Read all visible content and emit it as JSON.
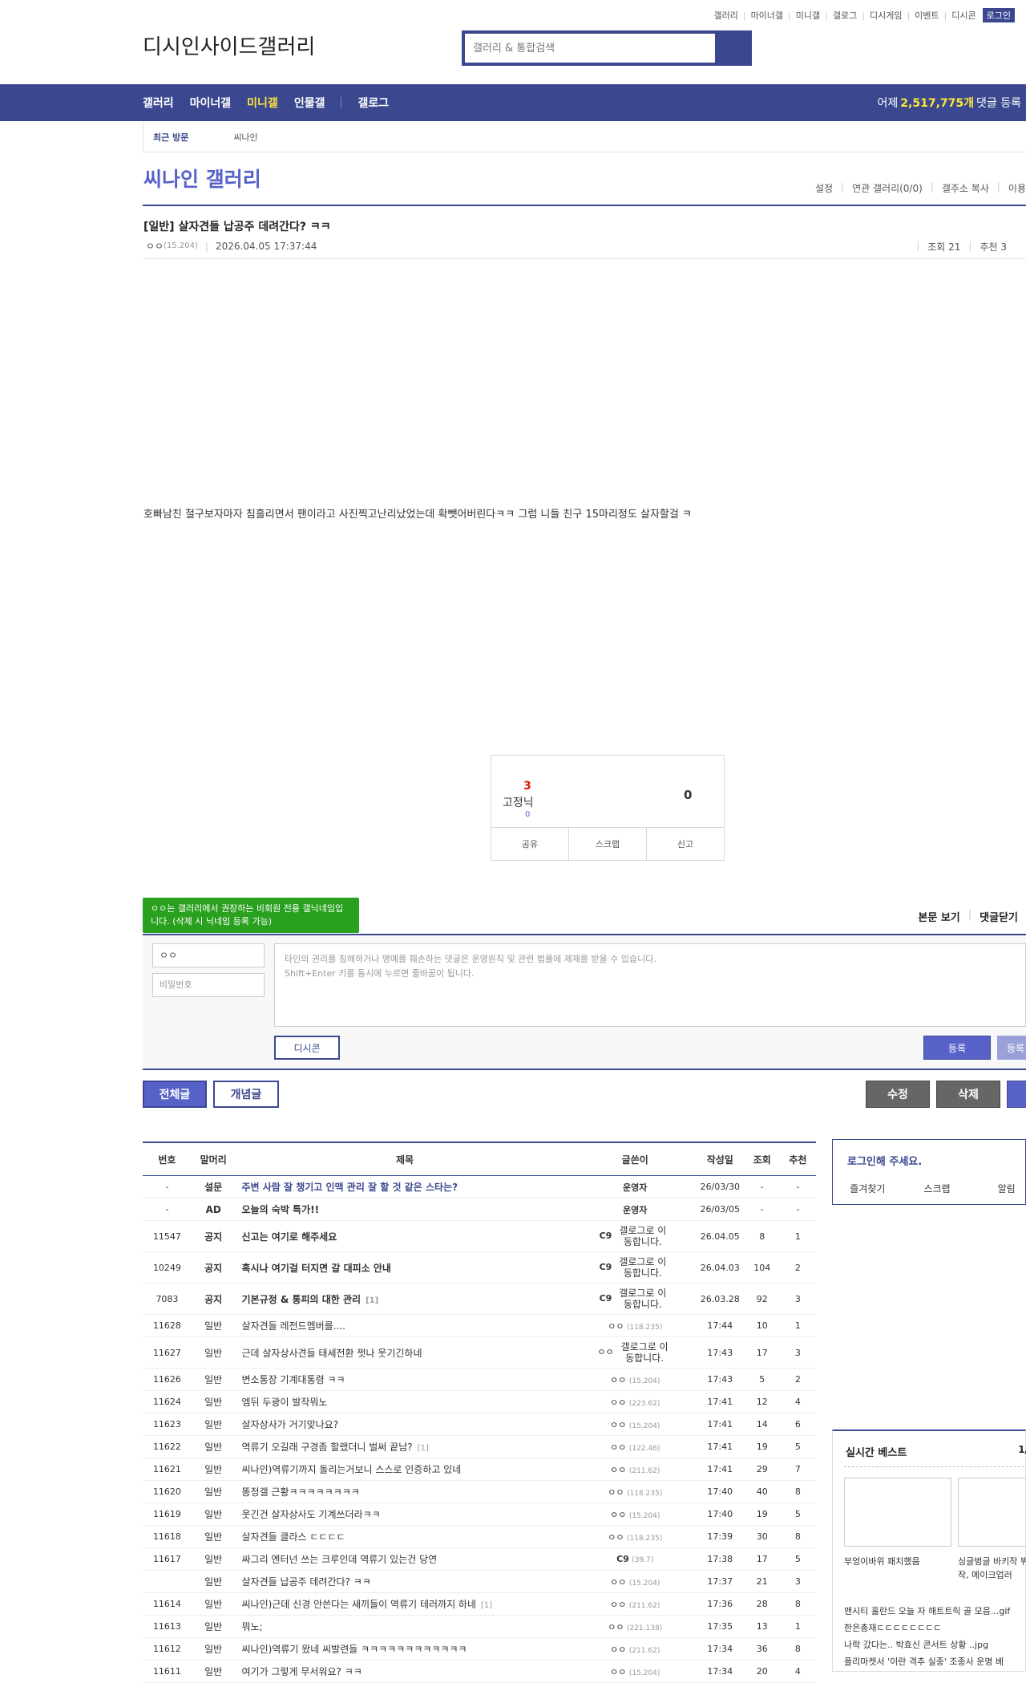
{
  "util_links": [
    "갤러리",
    "마이너갤",
    "미니갤",
    "갤로그",
    "디시게임",
    "이벤트",
    "디시콘"
  ],
  "util_login": "로그인",
  "logo_text": "디시인사이드갤러리",
  "search": {
    "placeholder": "갤러리 & 통합검색"
  },
  "nav": {
    "items": [
      {
        "label": "갤러리",
        "active": false
      },
      {
        "label": "마이너갤",
        "active": false
      },
      {
        "label": "미니갤",
        "active": true
      },
      {
        "label": "인물갤",
        "active": false
      }
    ],
    "gallog": "갤로그",
    "stat_prefix": "어제",
    "stat_count": "2,517,775개",
    "stat_suffix": "댓글 등록"
  },
  "recent": {
    "label": "최근 방문",
    "item": "씨나인"
  },
  "gallery": {
    "title": "씨나인 갤러리",
    "tools": [
      "설정",
      "연관 갤러리(0/0)",
      "갤주소 복사",
      "이용"
    ]
  },
  "post": {
    "head": "[일반]",
    "title": "살자견들 납공주 데려간다? ㅋㅋ",
    "author": "ㅇㅇ",
    "ip": "(15.204)",
    "date": "2026.04.05 17:37:44",
    "views_label": "조회 21",
    "recommend_label": "추천 3",
    "body": "호빠남친 철구보자마자 침흘리면서 팬이라고 사진찍고난리났었는데 확뺏어버린다ㅋㅋ 그럼 니들 친구 15마리정도 살자할걸 ㅋ"
  },
  "recommend": {
    "up_count": "3",
    "up_label": "고정닉",
    "fixed_count": "0",
    "down_count": "0",
    "buttons": [
      "공유",
      "스크랩",
      "신고"
    ]
  },
  "comment": {
    "tip": "ㅇㅇ는 갤러리에서 권장하는 비회원 전용 갤닉네임입니다. (삭제 시 닉네임 등록 가능)",
    "tools": [
      "본문 보기",
      "댓글닫기"
    ],
    "name": "ㅇㅇ",
    "password_placeholder": "비밀번호",
    "textarea_line1": "타인의 권리를 침해하거나 명예를 훼손하는 댓글은 운영원칙 및 관련 법률에 제재를 받을 수 있습니다.",
    "textarea_line2": "Shift+Enter 키를 동시에 누르면 줄바꿈이 됩니다.",
    "dccon": "디시콘",
    "submit": "등록",
    "submit2": "등록"
  },
  "list_buttons": {
    "all": "전체글",
    "best": "개념글",
    "edit": "수정",
    "delete": "삭제"
  },
  "list": {
    "headers": [
      "번호",
      "말머리",
      "제목",
      "글쓴이",
      "작성일",
      "조회",
      "추천"
    ],
    "rows": [
      {
        "no": "-",
        "head": "설문",
        "title": "주변 사람 잘 챙기고 인맥 관리 잘 할 것 같은 스타는?",
        "writer": "운영자",
        "ip": "",
        "date": "26/03/30",
        "views": "-",
        "rec": "-",
        "style": "survey"
      },
      {
        "no": "-",
        "head": "AD",
        "title": "오늘의 숙박 특가!!",
        "writer": "운영자",
        "ip": "",
        "date": "26/03/05",
        "views": "-",
        "rec": "-",
        "style": "ad"
      },
      {
        "no": "11547",
        "head": "공지",
        "title": "신고는 여기로 해주세요",
        "writer": "C9",
        "ip": "",
        "icon": "갤로그로 이동합니다.",
        "date": "26.04.05",
        "views": "8",
        "rec": "1",
        "style": "notice"
      },
      {
        "no": "10249",
        "head": "공지",
        "title": "혹시나 여기걸 터지면 갈 대피소 안내",
        "writer": "C9",
        "ip": "",
        "icon": "갤로그로 이동합니다.",
        "date": "26.04.03",
        "views": "104",
        "rec": "2",
        "style": "notice"
      },
      {
        "no": "7083",
        "head": "공지",
        "title": "기본규정 & 통피의 대한 관리",
        "count": "[1]",
        "writer": "C9",
        "ip": "",
        "icon": "갤로그로 이동합니다.",
        "date": "26.03.28",
        "views": "92",
        "rec": "3",
        "style": "notice"
      },
      {
        "no": "11628",
        "head": "일반",
        "title": "살자견들 레전드멤버를....",
        "writer": "ㅇㅇ",
        "ip": "(118.235)",
        "date": "17:44",
        "views": "10",
        "rec": "1"
      },
      {
        "no": "11627",
        "head": "일반",
        "title": "근데 살자상사견들 태세전환 쩟나 웃기긴하네",
        "writer": "ㅇㅇ",
        "ip": "",
        "icon": "갤로그로 이동합니다.",
        "date": "17:43",
        "views": "17",
        "rec": "3"
      },
      {
        "no": "11626",
        "head": "일반",
        "title": "변소통장 기계대통령 ㅋㅋ",
        "writer": "ㅇㅇ",
        "ip": "(15.204)",
        "date": "17:43",
        "views": "5",
        "rec": "2"
      },
      {
        "no": "11624",
        "head": "일반",
        "title": "엠뒤 두광이 발작뭐노",
        "writer": "ㅇㅇ",
        "ip": "(223.62)",
        "date": "17:41",
        "views": "12",
        "rec": "4"
      },
      {
        "no": "11623",
        "head": "일반",
        "title": "살자상사가 거기맞나요?",
        "writer": "ㅇㅇ",
        "ip": "(15.204)",
        "date": "17:41",
        "views": "14",
        "rec": "6"
      },
      {
        "no": "11622",
        "head": "일반",
        "title": "역류기 오길래 구경좀 할랬더니 벌써 끝남?",
        "count": "[1]",
        "writer": "ㅇㅇ",
        "ip": "(122.46)",
        "date": "17:41",
        "views": "19",
        "rec": "5"
      },
      {
        "no": "11621",
        "head": "일반",
        "title": "씨나인)역류기까지 돌리는거보니 스스로 인증하고 있네",
        "writer": "ㅇㅇ",
        "ip": "(211.62)",
        "date": "17:41",
        "views": "29",
        "rec": "7"
      },
      {
        "no": "11620",
        "head": "일반",
        "title": "똥정갤 근황ㅋㅋㅋㅋㅋㅋㅋㅋ",
        "writer": "ㅇㅇ",
        "ip": "(118.235)",
        "date": "17:40",
        "views": "40",
        "rec": "8"
      },
      {
        "no": "11619",
        "head": "일반",
        "title": "웃긴건 살자상사도 기계쓰더라ㅋㅋ",
        "writer": "ㅇㅇ",
        "ip": "(15.204)",
        "date": "17:40",
        "views": "19",
        "rec": "5"
      },
      {
        "no": "11618",
        "head": "일반",
        "title": "살자견들 클라스 ㄷㄷㄷㄷ",
        "writer": "ㅇㅇ",
        "ip": "(118.235)",
        "date": "17:39",
        "views": "30",
        "rec": "8"
      },
      {
        "no": "11617",
        "head": "일반",
        "title": "싸그리 엔터넌 쓰는 크루인데 역류기 있는건 당연",
        "writer": "C9",
        "ip": "(39.7)",
        "date": "17:38",
        "views": "17",
        "rec": "5"
      },
      {
        "no": "",
        "head": "일반",
        "title": "살자견들 납공주 데려간다? ㅋㅋ",
        "writer": "ㅇㅇ",
        "ip": "(15.204)",
        "date": "17:37",
        "views": "21",
        "rec": "3"
      },
      {
        "no": "11614",
        "head": "일반",
        "title": "씨나인)근데 신경 안쓴다는 새끼들이 역류기 테러까지 하네",
        "count": "[1]",
        "writer": "ㅇㅇ",
        "ip": "(211.62)",
        "date": "17:36",
        "views": "28",
        "rec": "8"
      },
      {
        "no": "11613",
        "head": "일반",
        "title": "뭐노;",
        "writer": "ㅇㅇ",
        "ip": "(221.138)",
        "date": "17:35",
        "views": "13",
        "rec": "1"
      },
      {
        "no": "11612",
        "head": "일반",
        "title": "씨나인)역류기 왔네 씨발련들 ㅋㅋㅋㅋㅋㅋㅋㅋㅋㅋㅋㅋ",
        "writer": "ㅇㅇ",
        "ip": "(211.62)",
        "date": "17:34",
        "views": "36",
        "rec": "8"
      },
      {
        "no": "11611",
        "head": "일반",
        "title": "여기가 그렇게 무서워요? ㅋㅋ",
        "writer": "ㅇㅇ",
        "ip": "(15.204)",
        "date": "17:34",
        "views": "20",
        "rec": "4"
      }
    ]
  },
  "sidebar": {
    "login_title": "로그인해 주세요.",
    "login_links": [
      "즐겨찾기",
      "스크랩",
      "알림"
    ],
    "best_title": "실시간 베스트",
    "best_page": "1/",
    "cap1": "부엉이바위 패치했음",
    "cap2": "싱글벙글 바키작 뷔작, 메이크업러",
    "best_rows": [
      "맨시티 홀란드 오늘 자 해트트릭 골 모음...gif",
      "한은총재ㄷㄷㄷㄷㄷㄷㄷㄷ",
      "나락 갔다는.. 박효신 콘서트 상황 ..jpg",
      "플리마켓서 '이란 격추 실종' 조종사 운명 베"
    ]
  }
}
